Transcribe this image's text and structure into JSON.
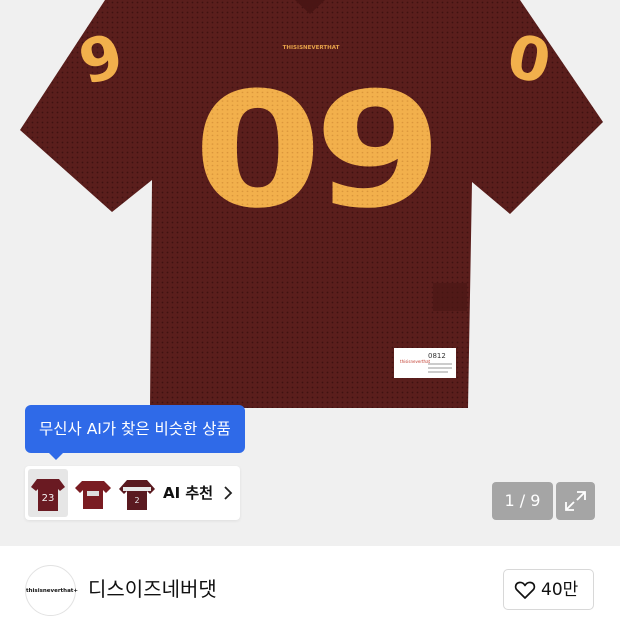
{
  "product_image": {
    "jersey_number": "09",
    "chest_logo_text": "THISISNEVERTHAT",
    "tag_brand_text": "thisisneverthat",
    "tag_code_text": "0812",
    "jersey_color": "#5a1e1c",
    "number_color": "#f2b04c"
  },
  "ai_recommendation": {
    "tooltip_text": "무신사 AI가 찾은 비슷한 상품",
    "label": "AI 추천",
    "thumbnails": [
      {
        "number": "23",
        "color": "#6a1a22"
      },
      {
        "number": "",
        "color": "#7a1c22"
      },
      {
        "number": "",
        "color": "#5a1a20"
      }
    ]
  },
  "gallery": {
    "counter": "1 / 9"
  },
  "brand": {
    "logo_text": "thisisneverthat+",
    "name": "디스이즈네버댓"
  },
  "like": {
    "count": "40만"
  },
  "colors": {
    "accent": "#2f6ae8",
    "background": "#f0f0f0"
  }
}
